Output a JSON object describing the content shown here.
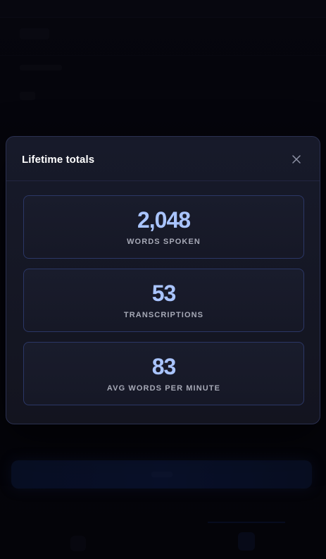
{
  "modal": {
    "title": "Lifetime totals",
    "close_icon": "close-icon",
    "stats": [
      {
        "value": "2,048",
        "label": "WORDS SPOKEN"
      },
      {
        "value": "53",
        "label": "TRANSCRIPTIONS"
      },
      {
        "value": "83",
        "label": "AVG WORDS PER MINUTE"
      }
    ]
  },
  "colors": {
    "accent_value": "#a9c4ff",
    "card_border": "#2b3766",
    "modal_background": "#171a2a",
    "page_background": "#07070c"
  }
}
